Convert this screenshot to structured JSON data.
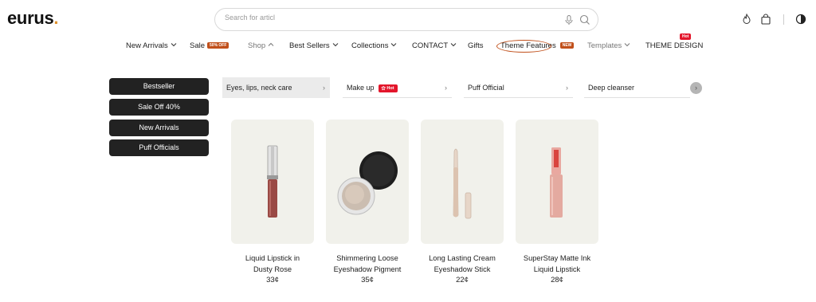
{
  "header": {
    "logo_text": "eurus",
    "logo_dot": ".",
    "search_placeholder": "Search for articl",
    "icons": [
      "fire-icon",
      "bag-icon",
      "theme-toggle-icon"
    ]
  },
  "nav": {
    "new_arrivals": "New Arrivals",
    "sale": "Sale",
    "sale_tag": "50% OFF",
    "shop": "Shop",
    "best_sellers": "Best Sellers",
    "collections": "Collections",
    "contact": "CONTACT",
    "gifts": "Gifts",
    "theme_features": "Theme Features",
    "theme_features_tag": "NEW",
    "templates": "Templates",
    "theme_design": "THEME DESIGN",
    "theme_design_tag": "Hot"
  },
  "sidebar": {
    "buttons": [
      "Bestseller",
      "Sale Off 40%",
      "New Arrivals",
      "Puff Officials"
    ]
  },
  "tabs": {
    "items": [
      "Eyes, lips, neck care",
      "Make up",
      "Puff Official",
      "Deep cleanser"
    ],
    "makeup_badge": "Hot"
  },
  "products": [
    {
      "title_line1": "Liquid Lipstick in",
      "title_line2": "Dusty Rose",
      "price": "33¢"
    },
    {
      "title_line1": "Shimmering Loose",
      "title_line2": "Eyeshadow Pigment",
      "price": "35¢"
    },
    {
      "title_line1": "Long Lasting Cream",
      "title_line2": "Eyeshadow Stick",
      "price": "22¢"
    },
    {
      "title_line1": "SuperStay Matte Ink",
      "title_line2": "Liquid Lipstick",
      "price": "28¢"
    }
  ],
  "colors": {
    "accent_orange": "#c1501b",
    "hot_red": "#e3162b",
    "button_dark": "#222222",
    "card_bg": "#f1f1eb"
  }
}
